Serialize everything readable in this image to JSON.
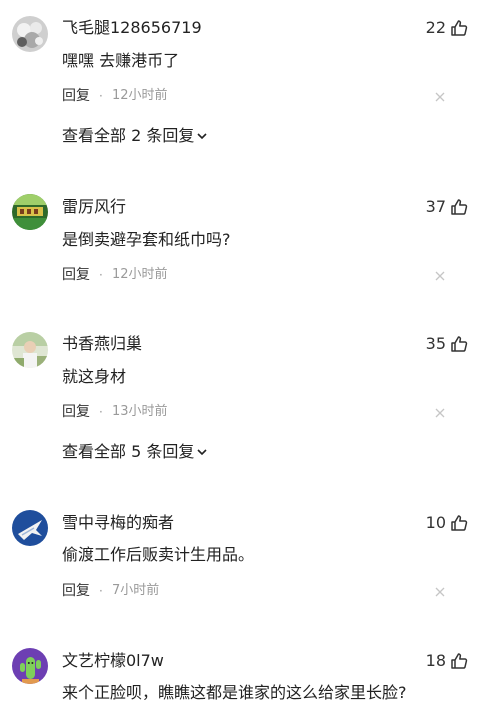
{
  "comments": [
    {
      "username": "飞毛腿128656719",
      "likes": "22",
      "content": "嘿嘿 去赚港币了",
      "reply_label": "回复",
      "separator": "·",
      "time": "12小时前",
      "view_all": "查看全部 2 条回复"
    },
    {
      "username": "雷厉风行",
      "likes": "37",
      "content": "是倒卖避孕套和纸巾吗?",
      "reply_label": "回复",
      "separator": "·",
      "time": "12小时前"
    },
    {
      "username": "书香燕归巢",
      "likes": "35",
      "content": "就这身材",
      "reply_label": "回复",
      "separator": "·",
      "time": "13小时前",
      "view_all": "查看全部 5 条回复"
    },
    {
      "username": "雪中寻梅的痴者",
      "likes": "10",
      "content": "偷渡工作后贩卖计生用品。",
      "reply_label": "回复",
      "separator": "·",
      "time": "7小时前"
    },
    {
      "username": "文艺柠檬0l7w",
      "likes": "18",
      "content": "来个正脸呗，瞧瞧这都是谁家的这么给家里长脸?"
    }
  ],
  "icons": {
    "like": "thumbs-up-icon",
    "close": "close-icon",
    "expand": "chevron-down-icon"
  }
}
